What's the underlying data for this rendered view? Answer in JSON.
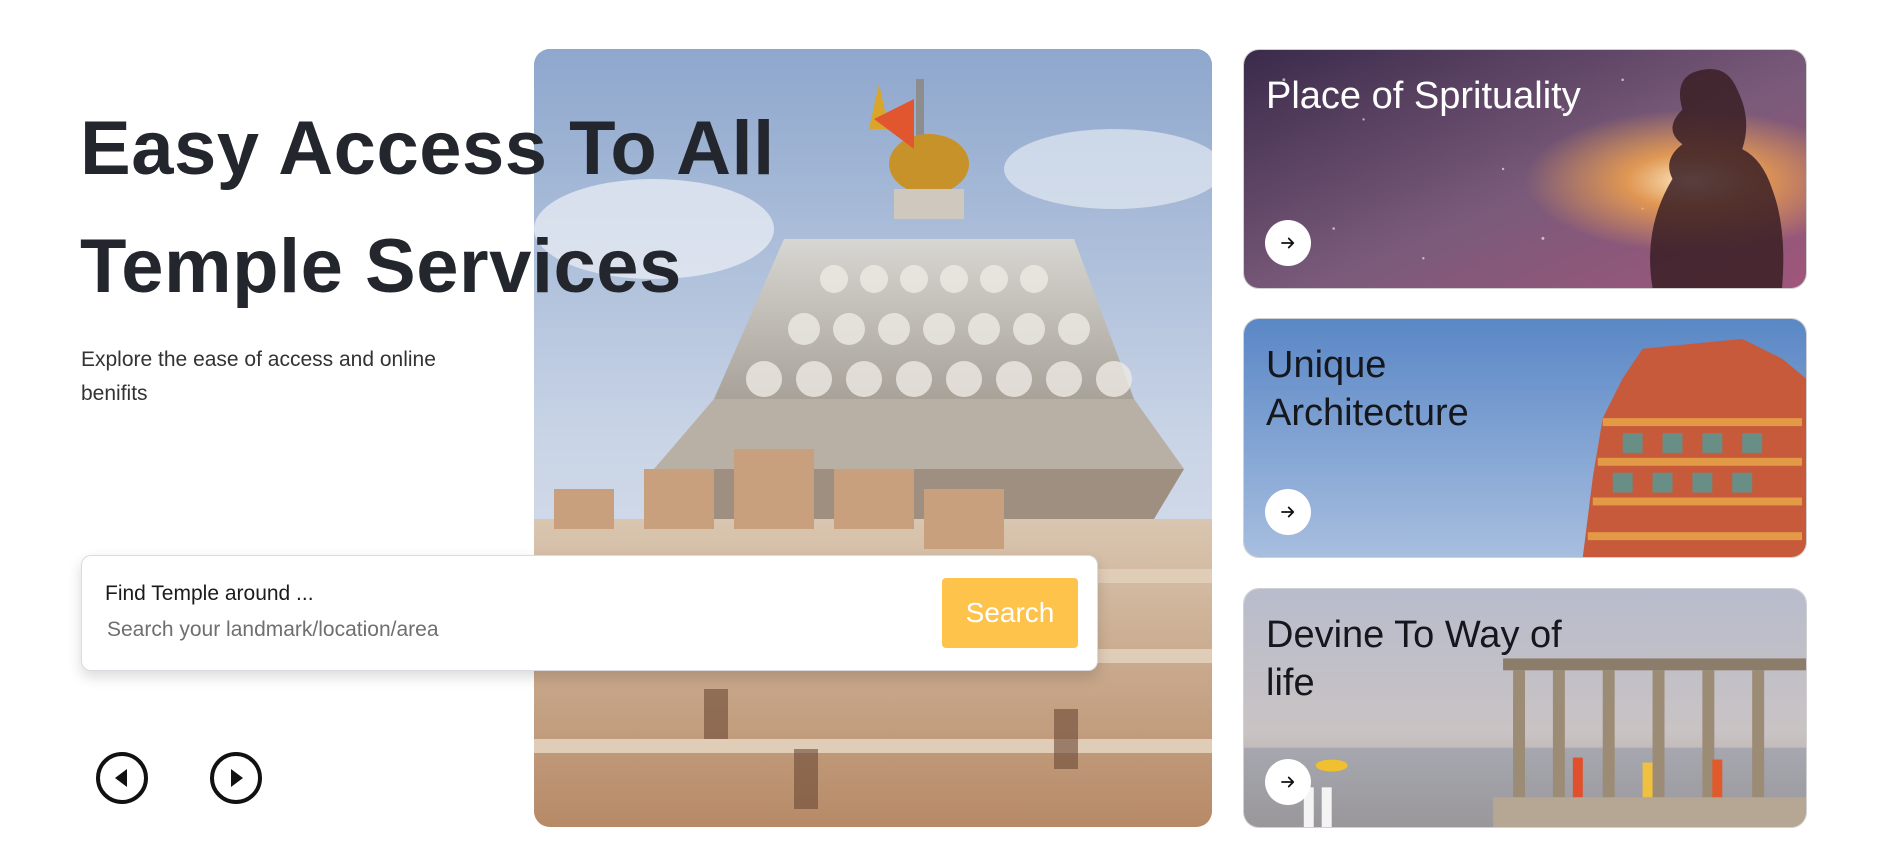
{
  "hero": {
    "title_line1": "Easy Access To All",
    "title_line2": "Temple Services",
    "subtitle": "Explore the ease of access and online benifits"
  },
  "search": {
    "label": "Find Temple around ...",
    "placeholder": "Search your landmark/location/area",
    "value": "",
    "button_label": "Search"
  },
  "carousel": {
    "prev_icon": "chevron-left-icon",
    "next_icon": "chevron-right-icon"
  },
  "cards": [
    {
      "title": "Place of Sprituality",
      "icon": "arrow-right-icon"
    },
    {
      "title": "Unique Architecture",
      "icon": "arrow-right-icon"
    },
    {
      "title": "Devine To Way of life",
      "icon": "arrow-right-icon"
    }
  ],
  "colors": {
    "accent": "#fdc34a",
    "heading": "#23262d",
    "text": "#333333"
  }
}
